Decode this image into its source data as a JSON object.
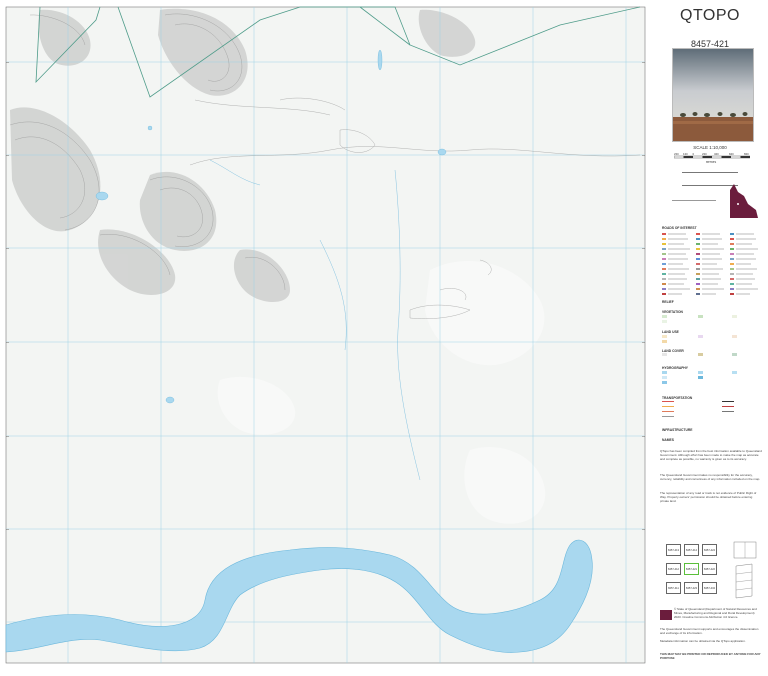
{
  "title": "QTOPO",
  "sheet_number": "8457-421",
  "scale_text": "SCALE 1:10,000",
  "scale_ticks": [
    "200",
    "100",
    "0",
    "200",
    "400",
    "600",
    "800"
  ],
  "scale_unit": "METRES",
  "map_colors": {
    "background": "#f3f5f3",
    "river": "#a9d8ef",
    "river_edge": "#6cb8dc",
    "grid": "#9fd3e6",
    "park_boundary": "#4f9c8a",
    "contour": "#8c8c8c"
  },
  "legend_sections": [
    "ROADS OF INTEREST",
    "RELIEF",
    "VEGETATION",
    "LAND USE",
    "LAND COVER",
    "HYDROGRAPHY",
    "TRANSPORTATION",
    "INFRASTRUCTURE",
    "NAMES"
  ],
  "disclaimer_paragraphs": [
    "QTopo has been compiled from the best information available to Queensland Government. Although effort has been made to make the map as accurate and complete as possible, no warranty is given as to its accuracy.",
    "The Queensland Government takes no responsibility for the accuracy, currency, reliability and correctness of any information included on the map.",
    "The representation of any road or track is not evidence of Public Right of Way. Property owners' permission should be obtained before entering private land."
  ],
  "index_sheets": [
    [
      "8457-413",
      "8457-414",
      "8457-424"
    ],
    [
      "8457-412",
      "8457-421",
      "8457-422"
    ],
    [
      "8457-411",
      "8457-423",
      "8457-434"
    ]
  ],
  "bottom_note": "THIS MAP MAY BE PRINTED OR REPRODUCED BY ANYONE FOR ANY PURPOSE",
  "copyright": "© State of Queensland (Department of Natural Resources and Mines, Manufacturing and Regional and Rural Development) 2023. Creative Commons Attribution 4.0 licence.",
  "support_text": "The Queensland Government supports and encourages the dissemination and exchange of its information.",
  "mobile_text": "Metadata information can be obtained via the QTopo application."
}
